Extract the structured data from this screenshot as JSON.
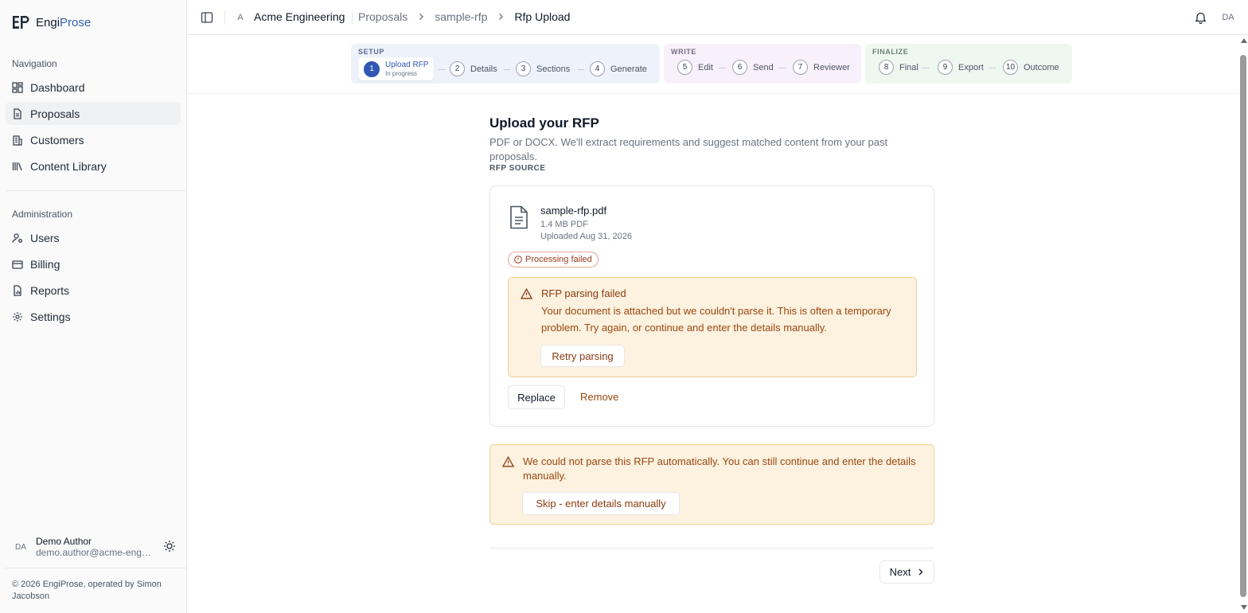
{
  "brand": {
    "name_main": "Engi",
    "name_accent": "Prose",
    "accent_color": "#2f5fb3"
  },
  "sidebar": {
    "nav_heading": "Navigation",
    "nav_items": [
      {
        "label": "Dashboard",
        "icon": "dashboard-icon"
      },
      {
        "label": "Proposals",
        "icon": "document-icon",
        "active": true
      },
      {
        "label": "Customers",
        "icon": "building-icon"
      },
      {
        "label": "Content Library",
        "icon": "library-icon"
      }
    ],
    "admin_heading": "Administration",
    "admin_items": [
      {
        "label": "Users",
        "icon": "user-cog-icon"
      },
      {
        "label": "Billing",
        "icon": "credit-card-icon"
      },
      {
        "label": "Reports",
        "icon": "report-icon"
      },
      {
        "label": "Settings",
        "icon": "gear-icon"
      }
    ],
    "user": {
      "initials": "DA",
      "name": "Demo Author",
      "email": "demo.author@acme-engineering.com"
    },
    "copyright": "© 2026 EngiProse, operated by Simon Jacobson"
  },
  "topbar": {
    "org_initial": "A",
    "org_name": "Acme Engineering",
    "breadcrumbs": [
      "Proposals",
      "sample-rfp",
      "Rfp Upload"
    ],
    "user_initials": "DA"
  },
  "stepper": {
    "phases": [
      {
        "label": "SETUP",
        "color": "#eef2fb"
      },
      {
        "label": "WRITE",
        "color": "#f8f1fb"
      },
      {
        "label": "FINALIZE",
        "color": "#eef8f1"
      }
    ],
    "current": {
      "num": "1",
      "title": "Upload RFP",
      "status": "In progress"
    },
    "steps": [
      {
        "num": "2",
        "label": "Details"
      },
      {
        "num": "3",
        "label": "Sections"
      },
      {
        "num": "4",
        "label": "Generate"
      },
      {
        "num": "5",
        "label": "Edit"
      },
      {
        "num": "6",
        "label": "Send"
      },
      {
        "num": "7",
        "label": "Reviewer"
      },
      {
        "num": "8",
        "label": "Final"
      },
      {
        "num": "9",
        "label": "Export"
      },
      {
        "num": "10",
        "label": "Outcome"
      }
    ]
  },
  "main": {
    "title": "Upload your RFP",
    "description": "PDF or DOCX. We'll extract requirements and suggest matched content from your past proposals.",
    "source_label": "RFP SOURCE",
    "file": {
      "name": "sample-rfp.pdf",
      "size": "1.4 MB PDF",
      "uploaded": "Uploaded Aug 31, 2026",
      "status": "Processing failed"
    },
    "parse_alert": {
      "title": "RFP parsing failed",
      "body": "Your document is attached but we couldn't parse it. This is often a temporary problem. Try again, or continue and enter the details manually.",
      "retry_label": "Retry parsing"
    },
    "replace_label": "Replace",
    "remove_label": "Remove",
    "notice": {
      "text": "We could not parse this RFP automatically. You can still continue and enter the details manually.",
      "skip_label": "Skip - enter details manually"
    },
    "next_label": "Next"
  }
}
